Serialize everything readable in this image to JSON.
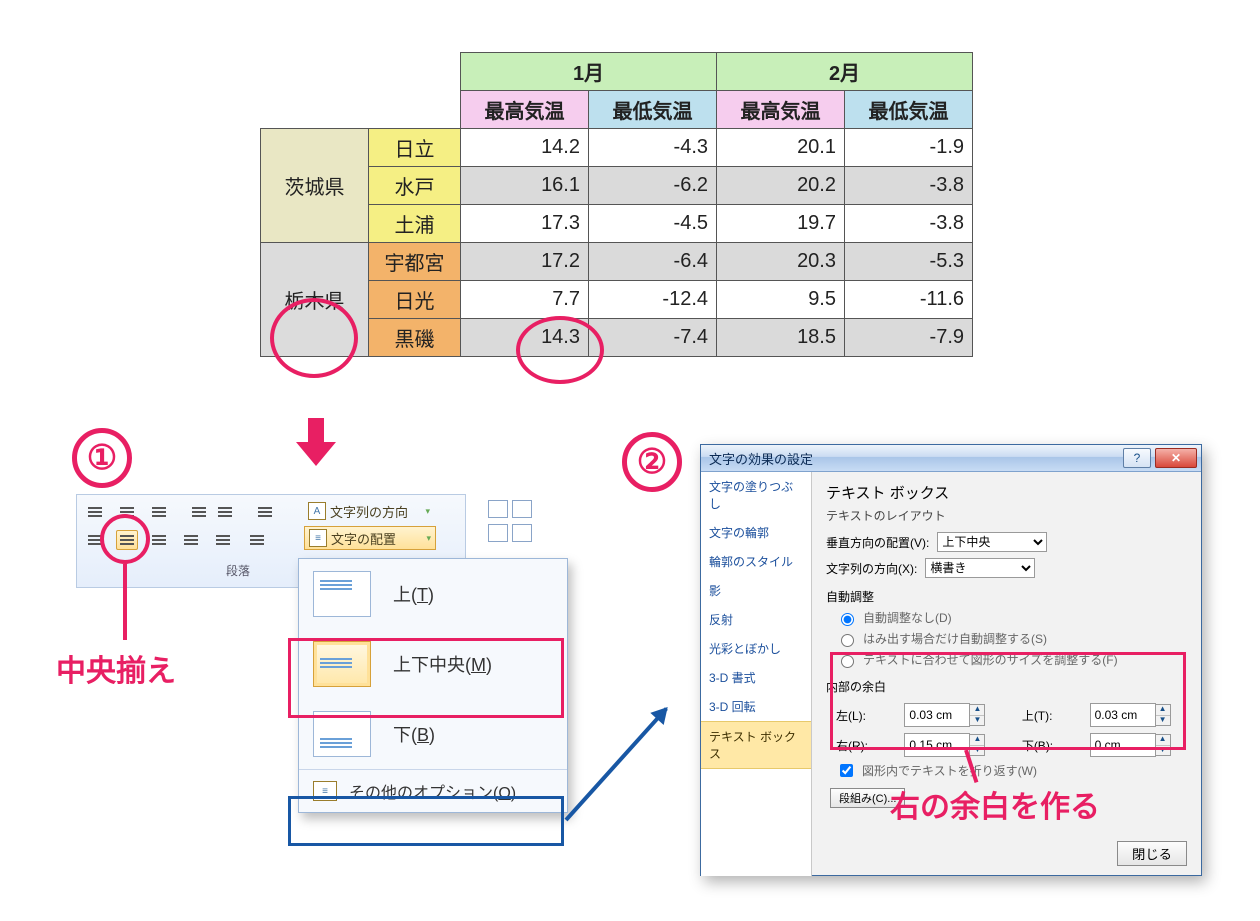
{
  "table": {
    "months": [
      "1月",
      "2月"
    ],
    "subheaders": [
      "最高気温",
      "最低気温"
    ],
    "groups": [
      {
        "pref": "茨城県",
        "rows": [
          {
            "city": "日立",
            "v": [
              "14.2",
              "-4.3",
              "20.1",
              "-1.9"
            ]
          },
          {
            "city": "水戸",
            "v": [
              "16.1",
              "-6.2",
              "20.2",
              "-3.8"
            ]
          },
          {
            "city": "土浦",
            "v": [
              "17.3",
              "-4.5",
              "19.7",
              "-3.8"
            ]
          }
        ]
      },
      {
        "pref": "栃木県",
        "rows": [
          {
            "city": "宇都宮",
            "v": [
              "17.2",
              "-6.4",
              "20.3",
              "-5.3"
            ]
          },
          {
            "city": "日光",
            "v": [
              "7.7",
              "-12.4",
              "9.5",
              "-11.6"
            ]
          },
          {
            "city": "黒磯",
            "v": [
              "14.3",
              "-7.4",
              "18.5",
              "-7.9"
            ]
          }
        ]
      }
    ]
  },
  "steps": {
    "one": "①",
    "two": "②"
  },
  "annotations": {
    "center_align": "中央揃え",
    "make_right_margin": "右の余白を作る"
  },
  "ribbon": {
    "group_label": "段落",
    "text_direction": "文字列の方向",
    "text_align_btn": "文字の配置",
    "menu": {
      "top": {
        "label": "上",
        "key": "T"
      },
      "middle": {
        "label": "上下中央",
        "key": "M"
      },
      "bottom": {
        "label": "下",
        "key": "B"
      },
      "other": {
        "label": "その他のオプション",
        "key": "O",
        "suffix": "..."
      }
    }
  },
  "dialog": {
    "title": "文字の効果の設定",
    "nav": [
      "文字の塗りつぶし",
      "文字の輪郭",
      "輪郭のスタイル",
      "影",
      "反射",
      "光彩とぼかし",
      "3-D 書式",
      "3-D 回転",
      "テキスト ボックス"
    ],
    "nav_selected": "テキスト ボックス",
    "pane": {
      "heading": "テキスト ボックス",
      "layout_label": "テキストのレイアウト",
      "valign_label": "垂直方向の配置(V):",
      "valign_value": "上下中央",
      "dir_label": "文字列の方向(X):",
      "dir_value": "横書き",
      "autofit_label": "自動調整",
      "autofit_opts": [
        "自動調整なし(D)",
        "はみ出す場合だけ自動調整する(S)",
        "テキストに合わせて図形のサイズを調整する(F)"
      ],
      "margins_label": "内部の余白",
      "left_l": "左(L):",
      "left_v": "0.03 cm",
      "top_l": "上(T):",
      "top_v": "0.03 cm",
      "right_l": "右(R):",
      "right_v": "0.15 cm",
      "bottom_l": "下(B):",
      "bottom_v": "0 cm",
      "wrap_label": "図形内でテキストを折り返す(W)",
      "columns_btn": "段組み(C)...",
      "close_btn": "閉じる"
    }
  }
}
